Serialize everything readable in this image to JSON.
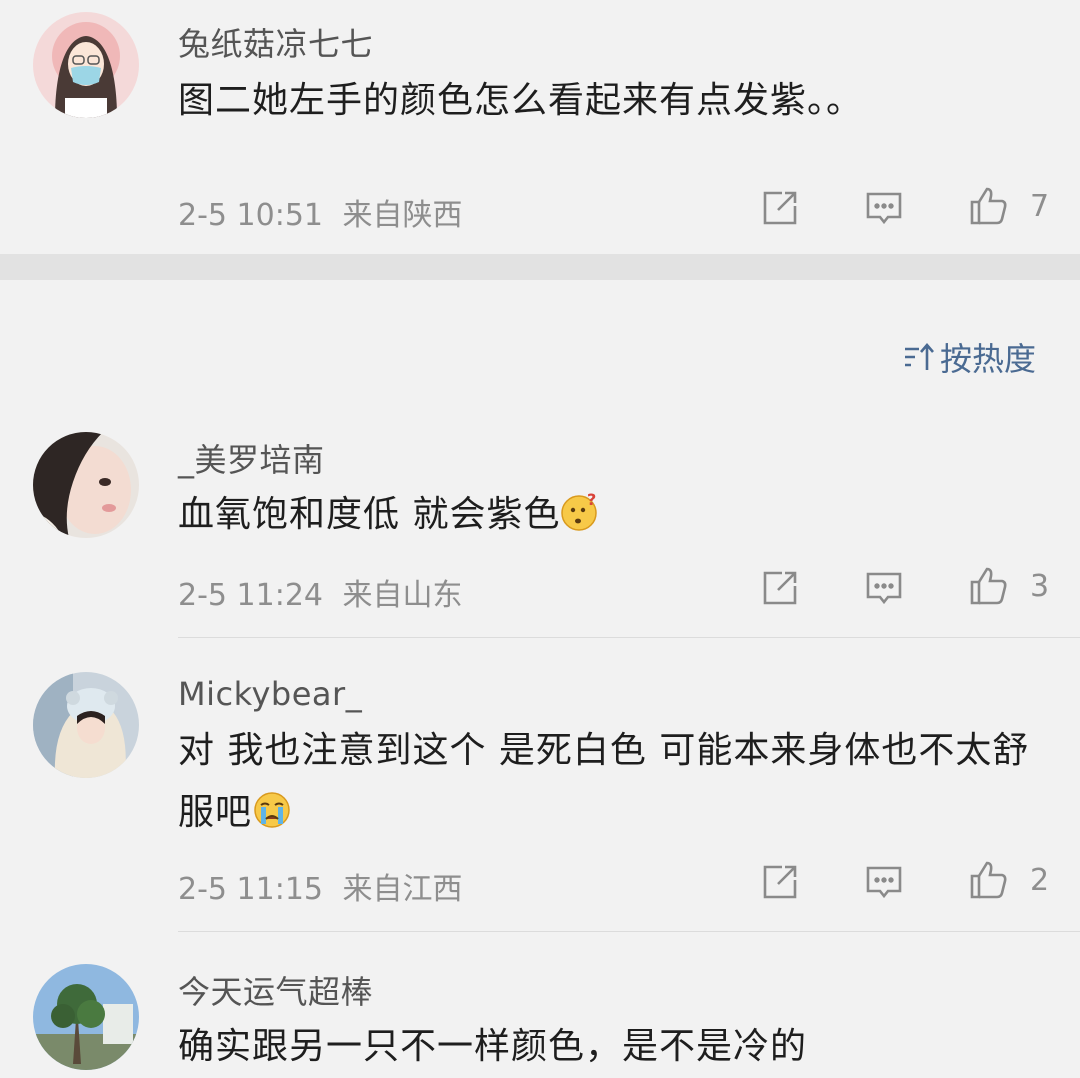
{
  "top_comment": {
    "username": "兔纸菇凉七七",
    "text": "图二她左手的颜色怎么看起来有点发紫。。",
    "time": "2-5 10:51",
    "location": "来自陕西",
    "likes": "7"
  },
  "sort_control": {
    "label": "按热度",
    "icon": "sort-icon"
  },
  "comments": [
    {
      "username": "_美罗培南",
      "text": "血氧饱和度低 就会紫色",
      "emoji": "confused-face-emoji",
      "time": "2-5 11:24",
      "location": "来自山东",
      "likes": "3"
    },
    {
      "username": "Mickybear_",
      "text": "对 我也注意到这个 是死白色 可能本来身体也不太舒服吧",
      "emoji": "crying-face-emoji",
      "time": "2-5 11:15",
      "location": "来自江西",
      "likes": "2"
    },
    {
      "username": "今天运气超棒",
      "text": "确实跟另一只不一样颜色，是不是冷的"
    }
  ],
  "colors": {
    "background": "#f2f2f2",
    "accent_sort": "#4a6a92",
    "meta_text": "#8e8e8e"
  }
}
